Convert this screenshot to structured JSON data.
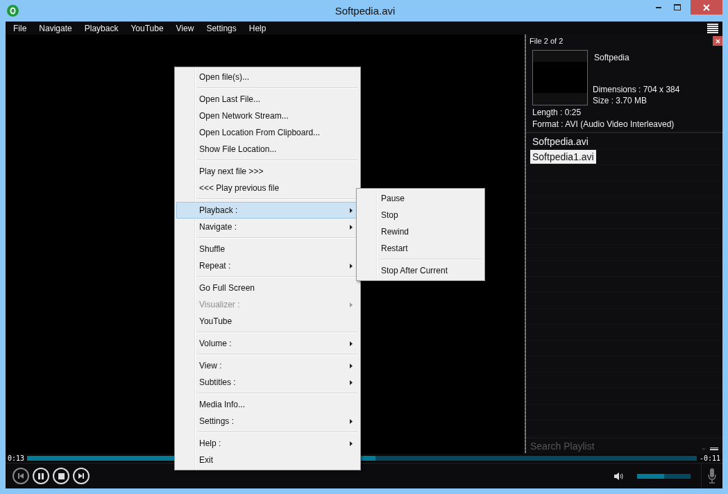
{
  "window": {
    "title": "Softpedia.avi"
  },
  "menu_bar": [
    "File",
    "Navigate",
    "Playback",
    "YouTube",
    "View",
    "Settings",
    "Help"
  ],
  "context_menu": {
    "groups": [
      [
        {
          "label": "Open file(s)...",
          "has_submenu": false,
          "disabled": false,
          "selected": false
        }
      ],
      [
        {
          "label": "Open Last File...",
          "has_submenu": false,
          "disabled": false,
          "selected": false
        },
        {
          "label": "Open Network Stream...",
          "has_submenu": false,
          "disabled": false,
          "selected": false
        },
        {
          "label": "Open Location From Clipboard...",
          "has_submenu": false,
          "disabled": false,
          "selected": false
        },
        {
          "label": "Show File Location...",
          "has_submenu": false,
          "disabled": false,
          "selected": false
        }
      ],
      [
        {
          "label": "Play next file >>>",
          "has_submenu": false,
          "disabled": false,
          "selected": false
        },
        {
          "label": "<<< Play previous file",
          "has_submenu": false,
          "disabled": false,
          "selected": false
        }
      ],
      [
        {
          "label": "Playback :",
          "has_submenu": true,
          "disabled": false,
          "selected": true
        },
        {
          "label": "Navigate :",
          "has_submenu": true,
          "disabled": false,
          "selected": false
        }
      ],
      [
        {
          "label": "Shuffle",
          "has_submenu": false,
          "disabled": false,
          "selected": false
        },
        {
          "label": "Repeat :",
          "has_submenu": true,
          "disabled": false,
          "selected": false
        }
      ],
      [
        {
          "label": "Go Full Screen",
          "has_submenu": false,
          "disabled": false,
          "selected": false
        },
        {
          "label": "Visualizer :",
          "has_submenu": true,
          "disabled": true,
          "selected": false
        },
        {
          "label": "YouTube",
          "has_submenu": false,
          "disabled": false,
          "selected": false
        }
      ],
      [
        {
          "label": "Volume :",
          "has_submenu": true,
          "disabled": false,
          "selected": false
        }
      ],
      [
        {
          "label": "View :",
          "has_submenu": true,
          "disabled": false,
          "selected": false
        },
        {
          "label": "Subtitles :",
          "has_submenu": true,
          "disabled": false,
          "selected": false
        }
      ],
      [
        {
          "label": "Media Info...",
          "has_submenu": false,
          "disabled": false,
          "selected": false
        },
        {
          "label": "Settings :",
          "has_submenu": true,
          "disabled": false,
          "selected": false
        }
      ],
      [
        {
          "label": "Help :",
          "has_submenu": true,
          "disabled": false,
          "selected": false
        },
        {
          "label": "Exit",
          "has_submenu": false,
          "disabled": false,
          "selected": false
        }
      ]
    ]
  },
  "submenu": {
    "groups": [
      [
        {
          "label": "Pause",
          "selected": false
        },
        {
          "label": "Stop",
          "selected": false
        },
        {
          "label": "Rewind",
          "selected": false
        },
        {
          "label": "Restart",
          "selected": false
        }
      ],
      [
        {
          "label": "Stop After Current",
          "selected": false
        }
      ]
    ]
  },
  "playlist": {
    "header": "File 2 of 2",
    "name": "Softpedia",
    "dimensions": "Dimensions : 704 x 384",
    "size": "Size : 3.70 MB",
    "length": "Length : 0:25",
    "format": "Format : AVI (Audio Video Interleaved)",
    "items": [
      {
        "label": "Softpedia.avi",
        "selected": false
      },
      {
        "label": "Softpedia1.avi",
        "selected": true
      }
    ],
    "search": {
      "placeholder": "Search Playlist"
    }
  },
  "seek": {
    "elapsed": "0:13",
    "remaining": "-0:11",
    "level": 0.52
  },
  "volume": {
    "level": 0.5
  }
}
